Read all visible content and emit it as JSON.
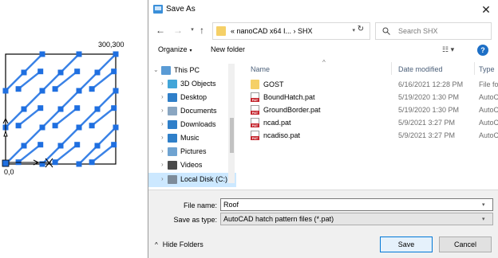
{
  "cad": {
    "coord_top": "300,300",
    "coord_bottom": "0,0"
  },
  "dialog": {
    "title": "Save As",
    "close_glyph": "✕",
    "nav": {
      "back_glyph": "←",
      "forward_glyph": "→",
      "dropdown_glyph": "▾",
      "up_glyph": "↑",
      "address_text": "«  nanoCAD x64 I...  ›  SHX",
      "address_chevron": "▾",
      "refresh_glyph": "↻",
      "search_placeholder": "Search SHX"
    },
    "toolbar": {
      "organize": "Organize",
      "organize_chevron": "▾",
      "new_folder": "New folder",
      "view_glyph": "☷ ▾",
      "help": "?"
    },
    "navpane": {
      "items": [
        {
          "label": "This PC",
          "icon": "pc-icon",
          "color": "#5a9bd5"
        },
        {
          "label": "3D Objects",
          "icon": "3d-objects-icon",
          "color": "#42a5d8"
        },
        {
          "label": "Desktop",
          "icon": "desktop-icon",
          "color": "#2f7fc9"
        },
        {
          "label": "Documents",
          "icon": "documents-icon",
          "color": "#8aa6c1"
        },
        {
          "label": "Downloads",
          "icon": "downloads-icon",
          "color": "#2f7fc9"
        },
        {
          "label": "Music",
          "icon": "music-icon",
          "color": "#2f7fc9"
        },
        {
          "label": "Pictures",
          "icon": "pictures-icon",
          "color": "#6fa3d1"
        },
        {
          "label": "Videos",
          "icon": "videos-icon",
          "color": "#4a4a4a"
        },
        {
          "label": "Local Disk (C:)",
          "icon": "disk-icon",
          "color": "#7d8b99"
        }
      ]
    },
    "filelist": {
      "headers": {
        "name": "Name",
        "date": "Date modified",
        "type": "Type"
      },
      "sort_glyph": "^",
      "rows": [
        {
          "name": "GOST",
          "date": "6/16/2021 12:28 PM",
          "type": "File fo",
          "kind": "folder"
        },
        {
          "name": "BoundHatch.pat",
          "date": "5/19/2020 1:30 PM",
          "type": "AutoC",
          "kind": "pat"
        },
        {
          "name": "GroundBorder.pat",
          "date": "5/19/2020 1:30 PM",
          "type": "AutoC",
          "kind": "pat"
        },
        {
          "name": "ncad.pat",
          "date": "5/9/2021 3:27 PM",
          "type": "AutoC",
          "kind": "pat"
        },
        {
          "name": "ncadiso.pat",
          "date": "5/9/2021 3:27 PM",
          "type": "AutoC",
          "kind": "pat"
        }
      ]
    },
    "form": {
      "file_name_label": "File name:",
      "file_name_value": "Roof",
      "file_name_chevron": "▾",
      "save_as_type_label": "Save as type:",
      "save_as_type_value": "AutoCAD hatch pattern files (*.pat)",
      "type_chevron": "▾",
      "hide_folders": "Hide Folders",
      "hide_folders_chevron": "^",
      "save": "Save",
      "cancel": "Cancel"
    }
  }
}
